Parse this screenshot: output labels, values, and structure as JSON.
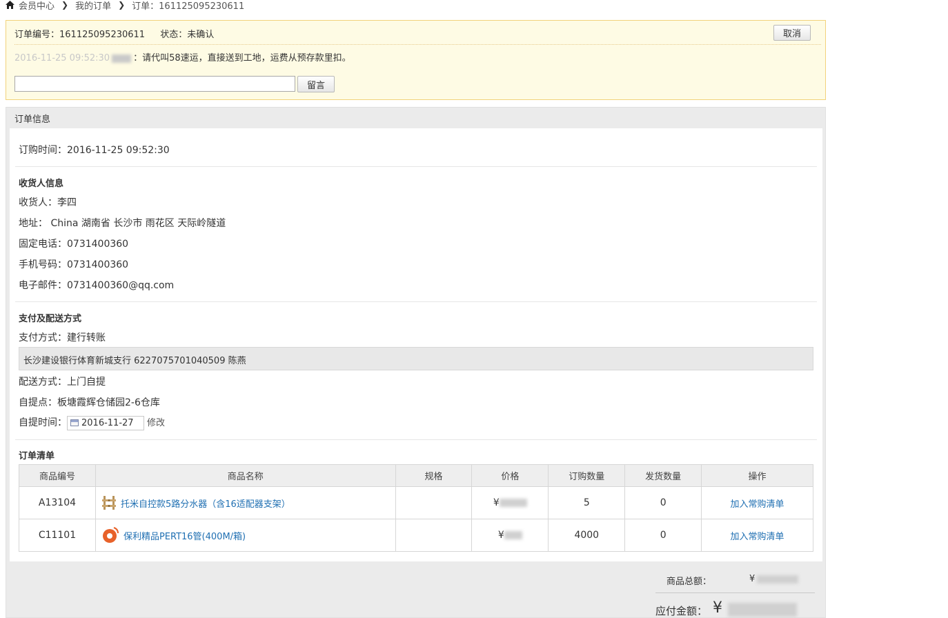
{
  "breadcrumb": {
    "items": [
      "会员中心",
      "我的订单",
      "订单：161125095230611"
    ]
  },
  "notice": {
    "order_no": "订单编号：161125095230611",
    "status": "状态：未确认",
    "cancel_label": "取消",
    "message_time": "2016-11-25 09:52:30",
    "message_text": "：请代叫58速运，直接送到工地，运费从预存款里扣。",
    "message_input_value": "",
    "message_button": "留言"
  },
  "panel": {
    "title": "订单信息",
    "order_time": "订购时间：2016-11-25 09:52:30",
    "receiver_section": "收货人信息",
    "receiver": "收货人：李四",
    "address": "地址： China 湖南省 长沙市 雨花区 天际岭隧道",
    "phone": "固定电话：0731400360",
    "mobile": "手机号码：0731400360",
    "email": "电子邮件：0731400360@qq.com",
    "pay_section": "支付及配送方式",
    "pay_method": "支付方式：建行转账",
    "bank_info": "长沙建设银行体育新城支行 6227075701040509 陈燕",
    "delivery": "配送方式：上门自提",
    "pickup_point": "自提点：板塘霞辉仓储园2-6仓库",
    "pickup_time_label": "自提时间：",
    "pickup_date": "2016-11-27",
    "edit_label": "修改",
    "list_section": "订单清单"
  },
  "table": {
    "headers": [
      "商品编号",
      "商品名称",
      "规格",
      "价格",
      "订购数量",
      "发货数量",
      "操作"
    ],
    "rows": [
      {
        "code": "A13104",
        "name": "托米自控款5路分水器（含16适配器支架）",
        "spec": "",
        "price_symbol": "¥",
        "qty": "5",
        "shipped": "0",
        "op": "加入常购清单",
        "icon": "manifold-icon"
      },
      {
        "code": "C11101",
        "name": "保利精品PERT16管(400M/箱)",
        "spec": "",
        "price_symbol": "¥",
        "qty": "4000",
        "shipped": "0",
        "op": "加入常购清单",
        "icon": "pipe-coil-icon"
      }
    ]
  },
  "totals": {
    "goods_total_label": "商品总额：",
    "goods_total_symbol": "¥",
    "payable_label": "应付金额：",
    "payable_symbol": "¥"
  },
  "colors": {
    "notice_bg": "#fefbe4",
    "notice_border": "#f2d27a",
    "link": "#1f6fb2"
  }
}
